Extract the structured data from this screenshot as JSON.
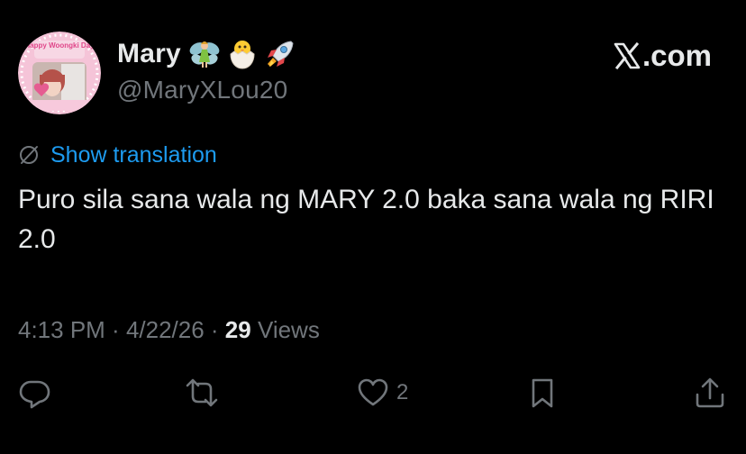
{
  "author": {
    "display_name": "Mary",
    "handle": "@MaryXLou20",
    "name_emojis": [
      "fairy-emoji",
      "hatching-chick-emoji",
      "rocket-emoji"
    ],
    "avatar": {
      "banner_text": "Happy Woongki Day",
      "caption": "Happy Woongki Day"
    }
  },
  "source": {
    "site": ".com",
    "logo": "x-logo-icon"
  },
  "translation": {
    "link_label": "Show translation",
    "icon": "translate-icon"
  },
  "tweet": {
    "text": "Puro sila sana wala ng MARY 2.0 baka sana wala ng RIRI 2.0"
  },
  "meta": {
    "time": "4:13 PM",
    "separator": " · ",
    "date": "4/22/26",
    "views_count": "29",
    "views_label": " Views"
  },
  "actions": {
    "reply": {
      "icon": "reply-icon",
      "count": ""
    },
    "retweet": {
      "icon": "retweet-icon",
      "count": ""
    },
    "like": {
      "icon": "heart-icon",
      "count": "2"
    },
    "bookmark": {
      "icon": "bookmark-icon",
      "count": ""
    },
    "share": {
      "icon": "share-icon",
      "count": ""
    }
  },
  "colors": {
    "background": "#000000",
    "primary_text": "#e7e9ea",
    "secondary_text": "#71767b",
    "link": "#1d9bf0",
    "avatar_frame": "#f7c9dc"
  }
}
